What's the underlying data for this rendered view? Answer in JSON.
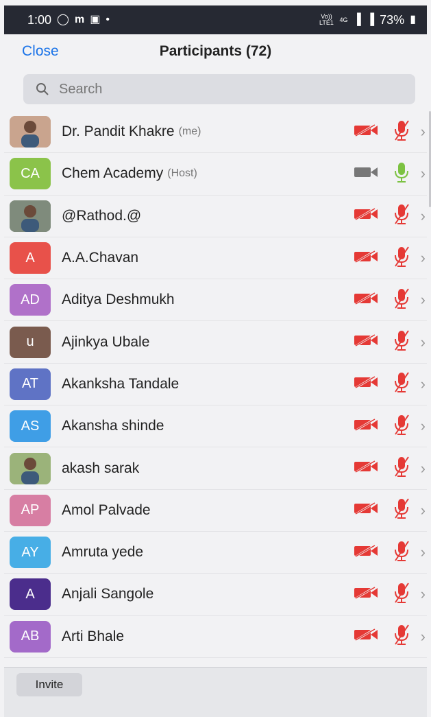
{
  "status_bar": {
    "time": "1:00",
    "battery": "73%",
    "network": "4G",
    "volte": "Vo)) LTE1"
  },
  "header": {
    "close_label": "Close",
    "title": "Participants (72)"
  },
  "search": {
    "placeholder": "Search"
  },
  "participants": [
    {
      "name": "Dr. Pandit Khakre",
      "role": "(me)",
      "initials": "",
      "avatar_color": "#c9a48e",
      "photo": true,
      "video_on": false,
      "audio_on": false
    },
    {
      "name": "Chem Academy",
      "role": "(Host)",
      "initials": "CA",
      "avatar_color": "#8bc34a",
      "photo": false,
      "video_on": true,
      "audio_on": true
    },
    {
      "name": "@Rathod.@",
      "role": "",
      "initials": "",
      "avatar_color": "#7f8b7c",
      "photo": true,
      "video_on": false,
      "audio_on": false
    },
    {
      "name": "A.A.Chavan",
      "role": "",
      "initials": "A",
      "avatar_color": "#e8514a",
      "photo": false,
      "video_on": false,
      "audio_on": false
    },
    {
      "name": "Aditya Deshmukh",
      "role": "",
      "initials": "AD",
      "avatar_color": "#b071c9",
      "photo": false,
      "video_on": false,
      "audio_on": false
    },
    {
      "name": "Ajinkya Ubale",
      "role": "",
      "initials": "u",
      "avatar_color": "#7a5b4e",
      "photo": false,
      "video_on": false,
      "audio_on": false
    },
    {
      "name": "Akanksha Tandale",
      "role": "",
      "initials": "AT",
      "avatar_color": "#5f73c5",
      "photo": false,
      "video_on": false,
      "audio_on": false
    },
    {
      "name": "Akansha shinde",
      "role": "",
      "initials": "AS",
      "avatar_color": "#3f9ee6",
      "photo": false,
      "video_on": false,
      "audio_on": false
    },
    {
      "name": "akash sarak",
      "role": "",
      "initials": "",
      "avatar_color": "#9bb37a",
      "photo": true,
      "video_on": false,
      "audio_on": false
    },
    {
      "name": "Amol Palvade",
      "role": "",
      "initials": "AP",
      "avatar_color": "#d77ea3",
      "photo": false,
      "video_on": false,
      "audio_on": false
    },
    {
      "name": "Amruta yede",
      "role": "",
      "initials": "AY",
      "avatar_color": "#47aee6",
      "photo": false,
      "video_on": false,
      "audio_on": false
    },
    {
      "name": "Anjali Sangole",
      "role": "",
      "initials": "A",
      "avatar_color": "#4b2d8c",
      "photo": false,
      "video_on": false,
      "audio_on": false
    },
    {
      "name": "Arti Bhale",
      "role": "",
      "initials": "AB",
      "avatar_color": "#a36ac9",
      "photo": false,
      "video_on": false,
      "audio_on": false
    }
  ],
  "footer": {
    "invite_label": "Invite"
  },
  "colors": {
    "accent": "#1a73e8",
    "muted_red": "#e53935",
    "unmuted_green": "#7cc242",
    "video_gray": "#777777"
  }
}
